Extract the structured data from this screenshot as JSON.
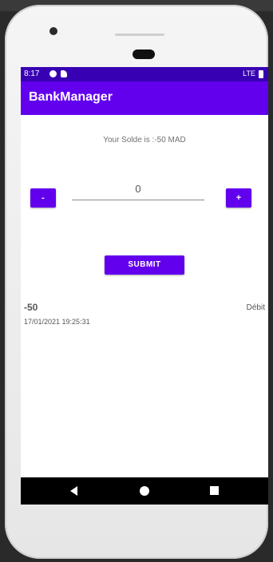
{
  "status_bar": {
    "time": "8:17",
    "network": "LTE"
  },
  "app_bar": {
    "title": "BankManager"
  },
  "balance": {
    "text": "Your Solde is :-50 MAD"
  },
  "controls": {
    "minus_label": "-",
    "plus_label": "+",
    "amount_value": "0",
    "submit_label": "SUBMIT"
  },
  "transactions": [
    {
      "amount": "-50",
      "type": "Débit",
      "date": "17/01/2021 19:25:31"
    }
  ],
  "colors": {
    "primary": "#6200ee",
    "primary_dark": "#3700b3"
  },
  "nav_icons": [
    "back-icon",
    "home-icon",
    "recents-icon"
  ]
}
